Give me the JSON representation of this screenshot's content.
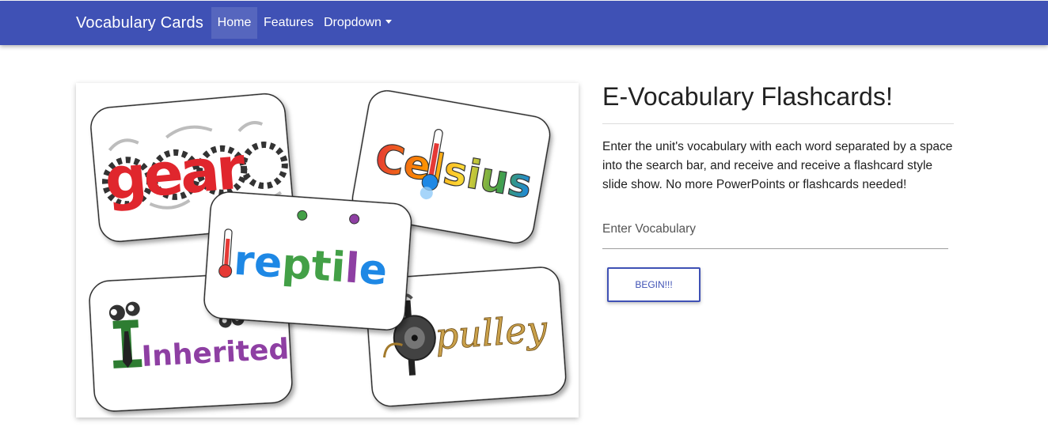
{
  "navbar": {
    "brand": "Vocabulary Cards",
    "items": [
      {
        "label": "Home",
        "active": true
      },
      {
        "label": "Features"
      },
      {
        "label": "Dropdown"
      }
    ]
  },
  "hero_image": {
    "cards": [
      "gear",
      "Celsius",
      "reptile",
      "Inherited",
      "pulley"
    ]
  },
  "main": {
    "heading": "E-Vocabulary Flashcards!",
    "description": "Enter the unit's vocabulary with each word separated by a space into the search bar, and receive and receive a flashcard style slide show. No more PowerPoints or flashcards needed!",
    "vocab_label": "Enter Vocabulary",
    "vocab_value": "",
    "begin_label": "BEGIN!!!"
  },
  "colors": {
    "primary": "#3f51b5",
    "nav_text": "#ffffff"
  }
}
